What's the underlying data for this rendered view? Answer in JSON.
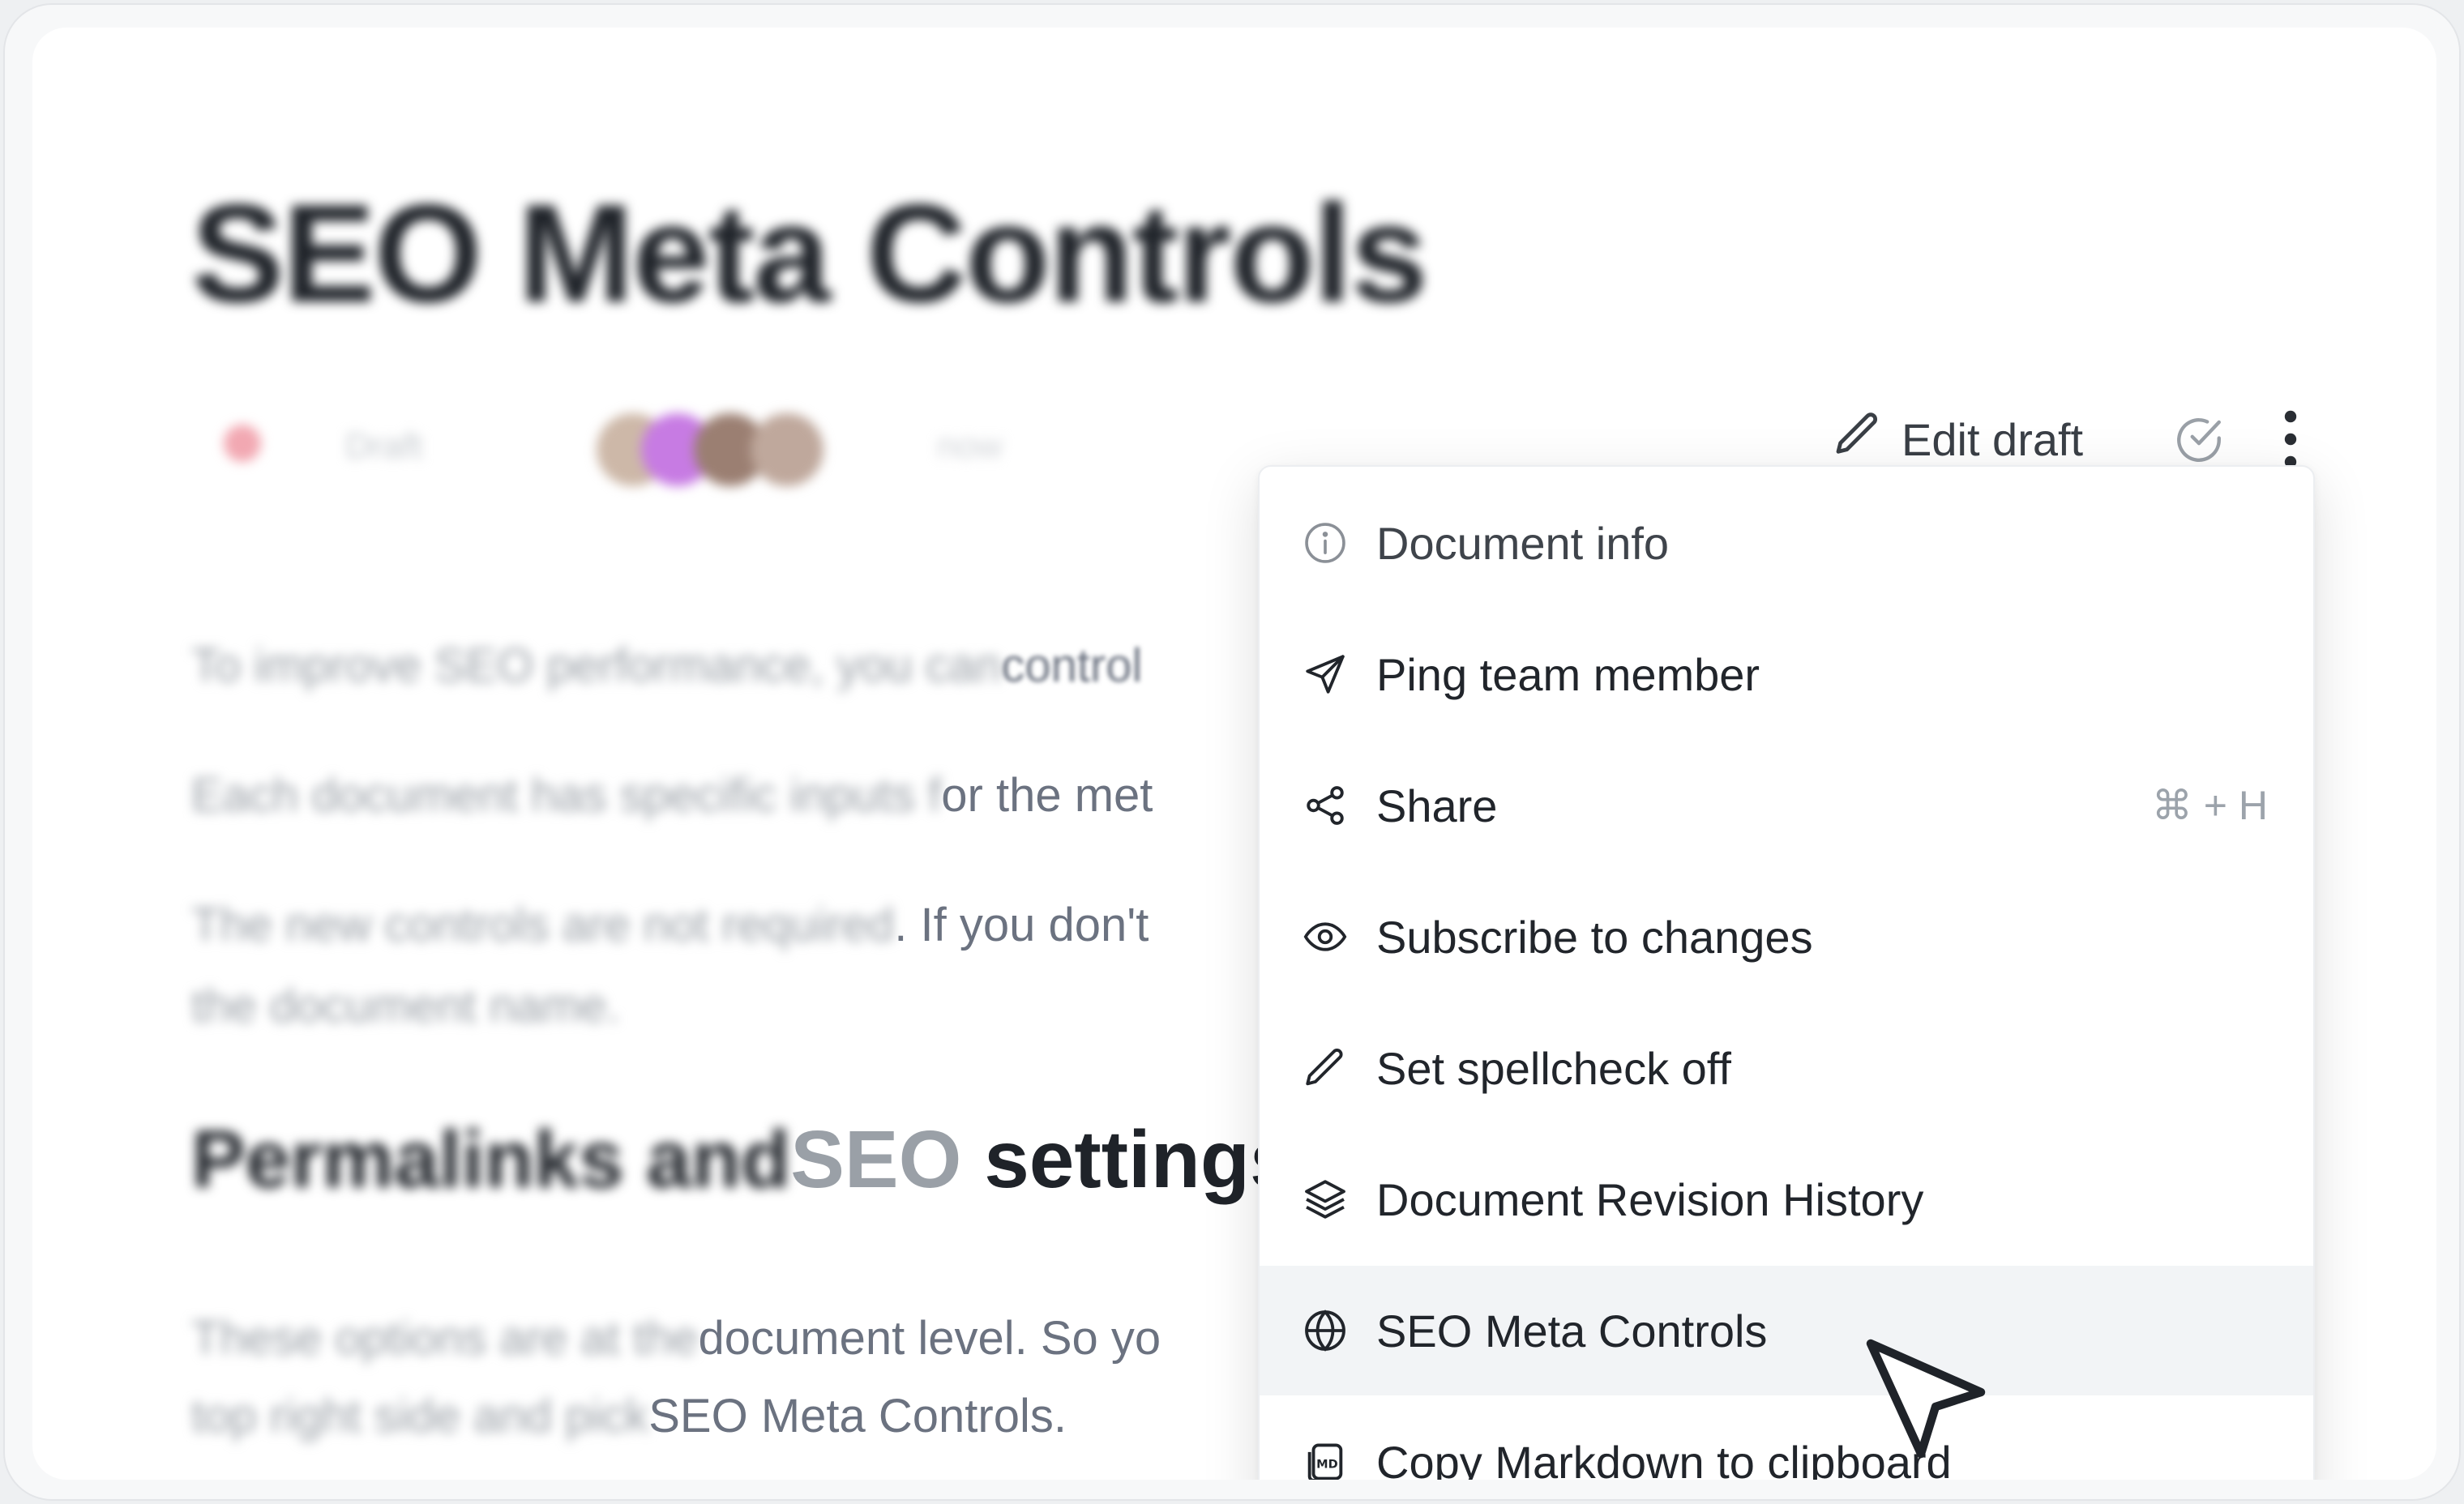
{
  "document": {
    "title": "SEO Meta Controls",
    "status": "Draft",
    "updated": "now",
    "paragraphs": [
      {
        "blurred": "To improve SEO performance, you can ",
        "visible": "control"
      },
      {
        "blurred": "Each document has specific inputs f",
        "visible": "or the met"
      },
      {
        "blurred": "The new controls are not required",
        "visible": ". If you don't"
      },
      {
        "blurred": "the document name.",
        "visible": ""
      }
    ],
    "heading": {
      "blurred": "Permalinks and ",
      "visible_faded": "SEO ",
      "visible": "settings"
    },
    "para5": {
      "blurred": "These options are at the ",
      "visible": "document level. So yo"
    },
    "para6": {
      "blurred": "top right side and pick ",
      "visible": "SEO Meta Controls."
    }
  },
  "toolbar": {
    "edit_label": "Edit draft",
    "edit_icon": "pencil-icon",
    "check_icon": "check-circle-icon",
    "more_icon": "more-vertical-icon"
  },
  "menu": {
    "items": [
      {
        "label": "Document info",
        "icon": "info-icon"
      },
      {
        "label": "Ping team member",
        "icon": "send-icon"
      },
      {
        "label": "Share",
        "icon": "share-icon",
        "shortcut": "⌘ + H"
      },
      {
        "label": "Subscribe to changes",
        "icon": "eye-icon"
      },
      {
        "label": "Set spellcheck off",
        "icon": "pencil-icon"
      },
      {
        "label": "Document Revision History",
        "icon": "layers-icon"
      },
      {
        "label": "SEO Meta Controls",
        "icon": "globe-icon",
        "active": true
      },
      {
        "label": "Copy Markdown to clipboard",
        "icon": "markdown-icon"
      }
    ]
  },
  "colors": {
    "accent_avatar": "#c77be3",
    "hover": "#f2f4f6",
    "text": "#21252b"
  }
}
